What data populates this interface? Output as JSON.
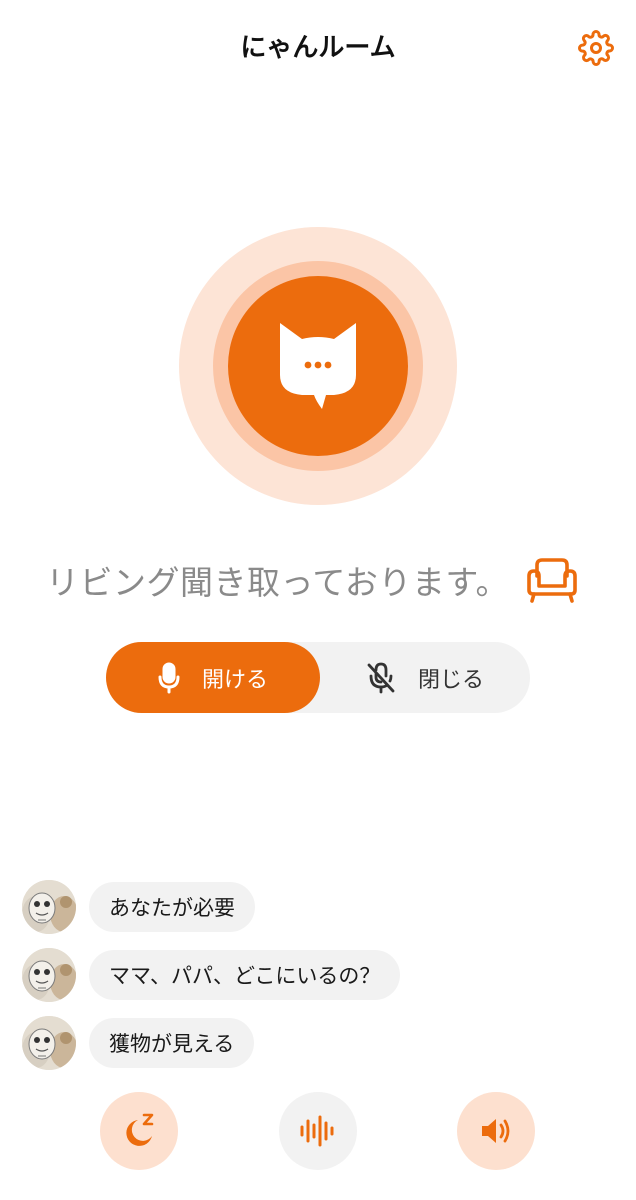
{
  "header": {
    "title": "にゃんルーム"
  },
  "status": {
    "text": "リビング聞き取っております。"
  },
  "mic_toggle": {
    "open_label": "開ける",
    "close_label": "閉じる"
  },
  "messages": [
    {
      "text": "あなたが必要"
    },
    {
      "text": "ママ、パパ、どこにいるの？"
    },
    {
      "text": "獲物が見える"
    }
  ],
  "icons": {
    "settings": "gear-icon",
    "talk": "cat-chat-icon",
    "room": "armchair-icon",
    "mic_on": "microphone-icon",
    "mic_off": "microphone-off-icon",
    "sleep": "moon-sleep-icon",
    "voice": "sound-wave-icon",
    "sound": "speaker-icon"
  },
  "colors": {
    "accent": "#ec6c0d",
    "accent_light": "#fde0cf",
    "ring_outer": "#fde4d6",
    "ring_mid": "#fbc5a6",
    "bubble_bg": "#f2f2f2",
    "status_text": "#8a8a8a"
  }
}
